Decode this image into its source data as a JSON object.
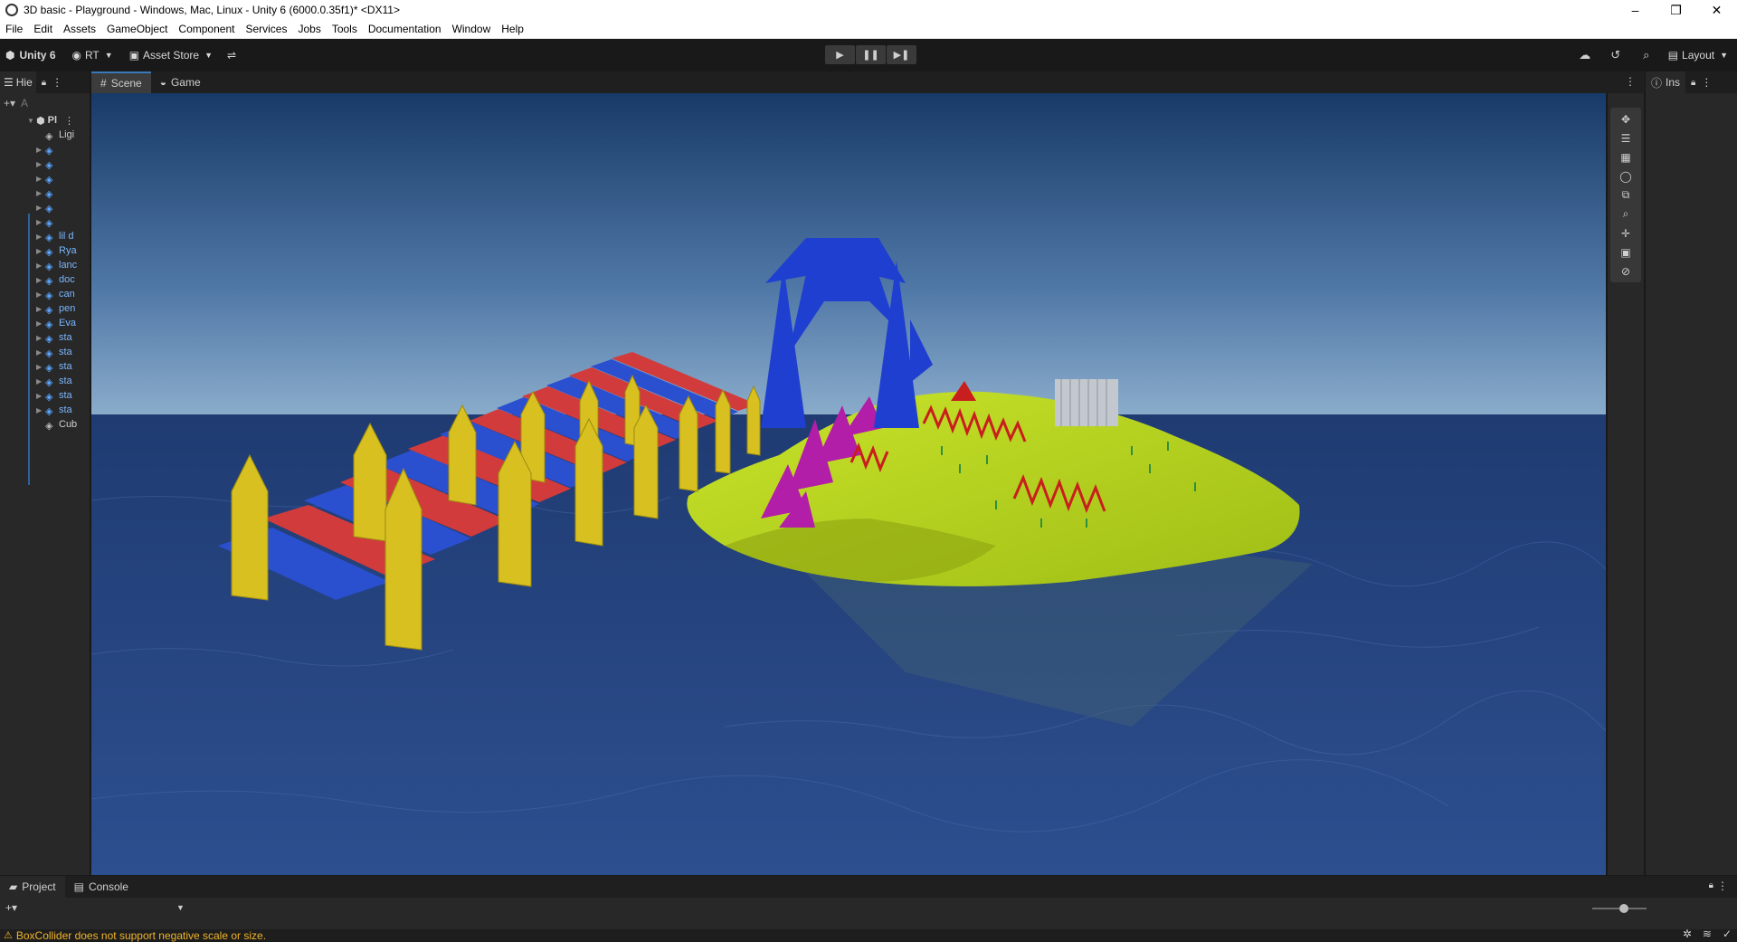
{
  "window": {
    "title": "3D basic - Playground - Windows, Mac, Linux - Unity 6 (6000.0.35f1)* <DX11>",
    "minimize": "–",
    "maximize": "❐",
    "close": "✕"
  },
  "menu": [
    "File",
    "Edit",
    "Assets",
    "GameObject",
    "Component",
    "Services",
    "Jobs",
    "Tools",
    "Documentation",
    "Window",
    "Help"
  ],
  "toolbar": {
    "account": "Unity 6",
    "rt": "RT",
    "asset_store": "Asset Store",
    "layout": "Layout"
  },
  "hierarchy": {
    "tab": "Hie",
    "search_placeholder": "A",
    "scene": "Pl",
    "items": [
      "Ligi",
      "",
      "",
      "",
      "",
      "",
      "",
      "lil d",
      "Rya",
      "lanc",
      "doc",
      "can",
      "pen",
      "Eva",
      "sta",
      "sta",
      "sta",
      "sta",
      "sta",
      "sta",
      "Cub"
    ]
  },
  "scene_view": {
    "tabs": [
      "Scene",
      "Game"
    ]
  },
  "inspector": {
    "tab": "Ins"
  },
  "bottom": {
    "tabs": [
      "Project",
      "Console"
    ]
  },
  "status": {
    "message": "BoxCollider does not support negative scale or size."
  },
  "colors": {
    "sky_top": "#1a3f6e",
    "sky_horizon": "#86a6c6",
    "ocean": "#26457e",
    "island": "#b7d51f",
    "bridge_post": "#d7c020",
    "plank_red": "#d23b3b",
    "plank_blue": "#2a4fcf",
    "arch": "#1f3fd0",
    "warning": "#f0b429"
  }
}
